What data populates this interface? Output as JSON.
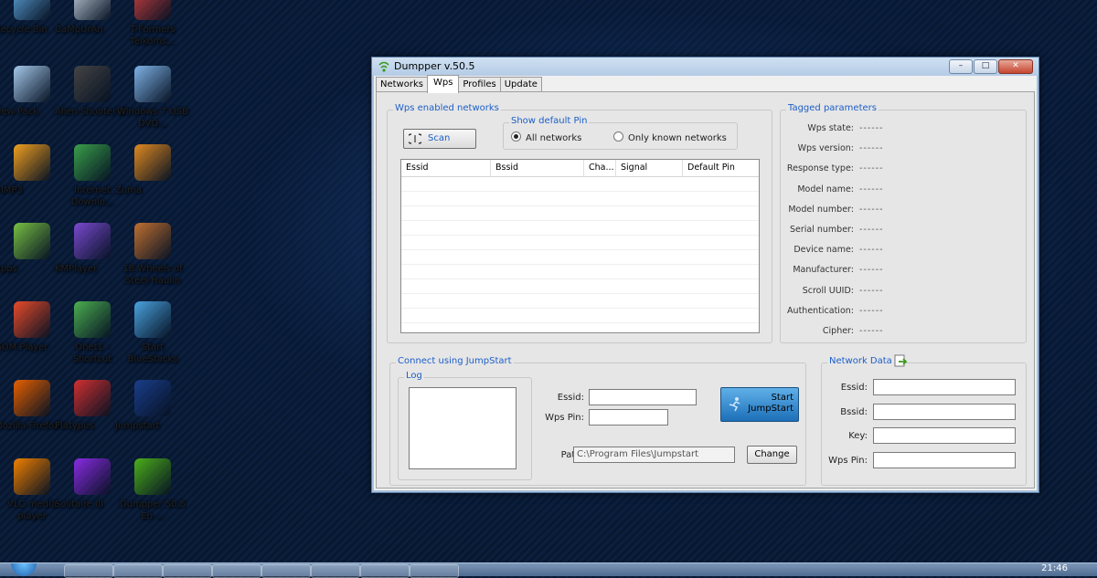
{
  "desktop": {
    "icons": [
      {
        "label": "Recycle Bin",
        "icon": "recycle-bin-icon",
        "color": "#5fa8e0"
      },
      {
        "label": "CaMpUrAn",
        "icon": "folder-icon",
        "color": "#c9d6e3"
      },
      {
        "label": "T-Formers Telkoms...",
        "icon": "app-icon",
        "color": "#d04040"
      },
      {
        "label": "New Pack",
        "icon": "file-icon",
        "color": "#a5c8ea"
      },
      {
        "label": "Alien Shooter 2",
        "icon": "game-icon",
        "color": "#444444"
      },
      {
        "label": "Windows 7 USB DVD...",
        "icon": "disc-icon",
        "color": "#7fb3e6"
      },
      {
        "label": "AIMP3",
        "icon": "aimp-icon",
        "color": "#f0a020"
      },
      {
        "label": "Internet Downlo...",
        "icon": "download-icon",
        "color": "#3aa04a"
      },
      {
        "label": "Zuma",
        "icon": "zuma-icon",
        "color": "#e08a20"
      },
      {
        "label": "Apps",
        "icon": "android-icon",
        "color": "#78c042"
      },
      {
        "label": "KMPlayer",
        "icon": "kmplayer-icon",
        "color": "#7a4ad0"
      },
      {
        "label": "18 Wheels of Steel Haulin",
        "icon": "truck-icon",
        "color": "#c07030"
      },
      {
        "label": "GOM Player",
        "icon": "gom-icon",
        "color": "#e84b2a"
      },
      {
        "label": "Onet1 - Shortcut",
        "icon": "dragon-icon",
        "color": "#4caf50"
      },
      {
        "label": "Start BlueStacks",
        "icon": "bluestacks-icon",
        "color": "#4aa3df"
      },
      {
        "label": "Mozilla Firefox",
        "icon": "firefox-icon",
        "color": "#e66000"
      },
      {
        "label": "Platypus",
        "icon": "platypus-icon",
        "color": "#d03030"
      },
      {
        "label": "Jumpstart",
        "icon": "jumpstart-icon",
        "color": "#1a3e8a"
      },
      {
        "label": "VLC media player",
        "icon": "vlc-icon",
        "color": "#f08000"
      },
      {
        "label": "Solitaire III",
        "icon": "cards-icon",
        "color": "#8a2be2"
      },
      {
        "label": "Dumpper 50.5 En ...",
        "icon": "wifi-icon",
        "color": "#4caf1a"
      }
    ]
  },
  "window": {
    "title": "Dumpper v.50.5",
    "controls": {
      "minimize": "–",
      "maximize": "□",
      "close": "✕"
    },
    "tabs": [
      {
        "label": "Networks",
        "active": false
      },
      {
        "label": "Wps",
        "active": true
      },
      {
        "label": "Profiles",
        "active": false
      },
      {
        "label": "Update",
        "active": false
      }
    ]
  },
  "wps": {
    "group_title": "Wps enabled networks",
    "scan_label": "Scan",
    "pin_group_title": "Show default Pin",
    "radio_all": "All networks",
    "radio_known": "Only known networks",
    "selected_radio": "All networks",
    "columns": [
      "Essid",
      "Bssid",
      "Cha...",
      "Signal",
      "Default Pin"
    ]
  },
  "tagged": {
    "title": "Tagged parameters",
    "rows": [
      {
        "key": "Wps state:",
        "value": "------"
      },
      {
        "key": "Wps version:",
        "value": "------"
      },
      {
        "key": "Response type:",
        "value": "------"
      },
      {
        "key": "Model name:",
        "value": "------"
      },
      {
        "key": "Model number:",
        "value": "------"
      },
      {
        "key": "Serial number:",
        "value": "------"
      },
      {
        "key": "Device name:",
        "value": "------"
      },
      {
        "key": "Manufacturer:",
        "value": "------"
      },
      {
        "key": "Scroll UUID:",
        "value": "------"
      },
      {
        "key": "Authentication:",
        "value": "------"
      },
      {
        "key": "Cipher:",
        "value": "------"
      }
    ]
  },
  "jumpstart": {
    "group_title": "Connect using JumpStart",
    "log_title": "Log",
    "essid_label": "Essid:",
    "essid_value": "",
    "wpspin_label": "Wps Pin:",
    "wpspin_value": "",
    "start_label": "Start JumpStart",
    "path_label": "Path:",
    "path_value": "C:\\Program Files\\Jumpstart",
    "change_label": "Change"
  },
  "network_data": {
    "title": "Network Data",
    "fields": [
      {
        "label": "Essid:",
        "value": ""
      },
      {
        "label": "Bssid:",
        "value": ""
      },
      {
        "label": "Key:",
        "value": ""
      },
      {
        "label": "Wps Pin:",
        "value": ""
      }
    ]
  },
  "taskbar": {
    "clock": "21:46"
  }
}
